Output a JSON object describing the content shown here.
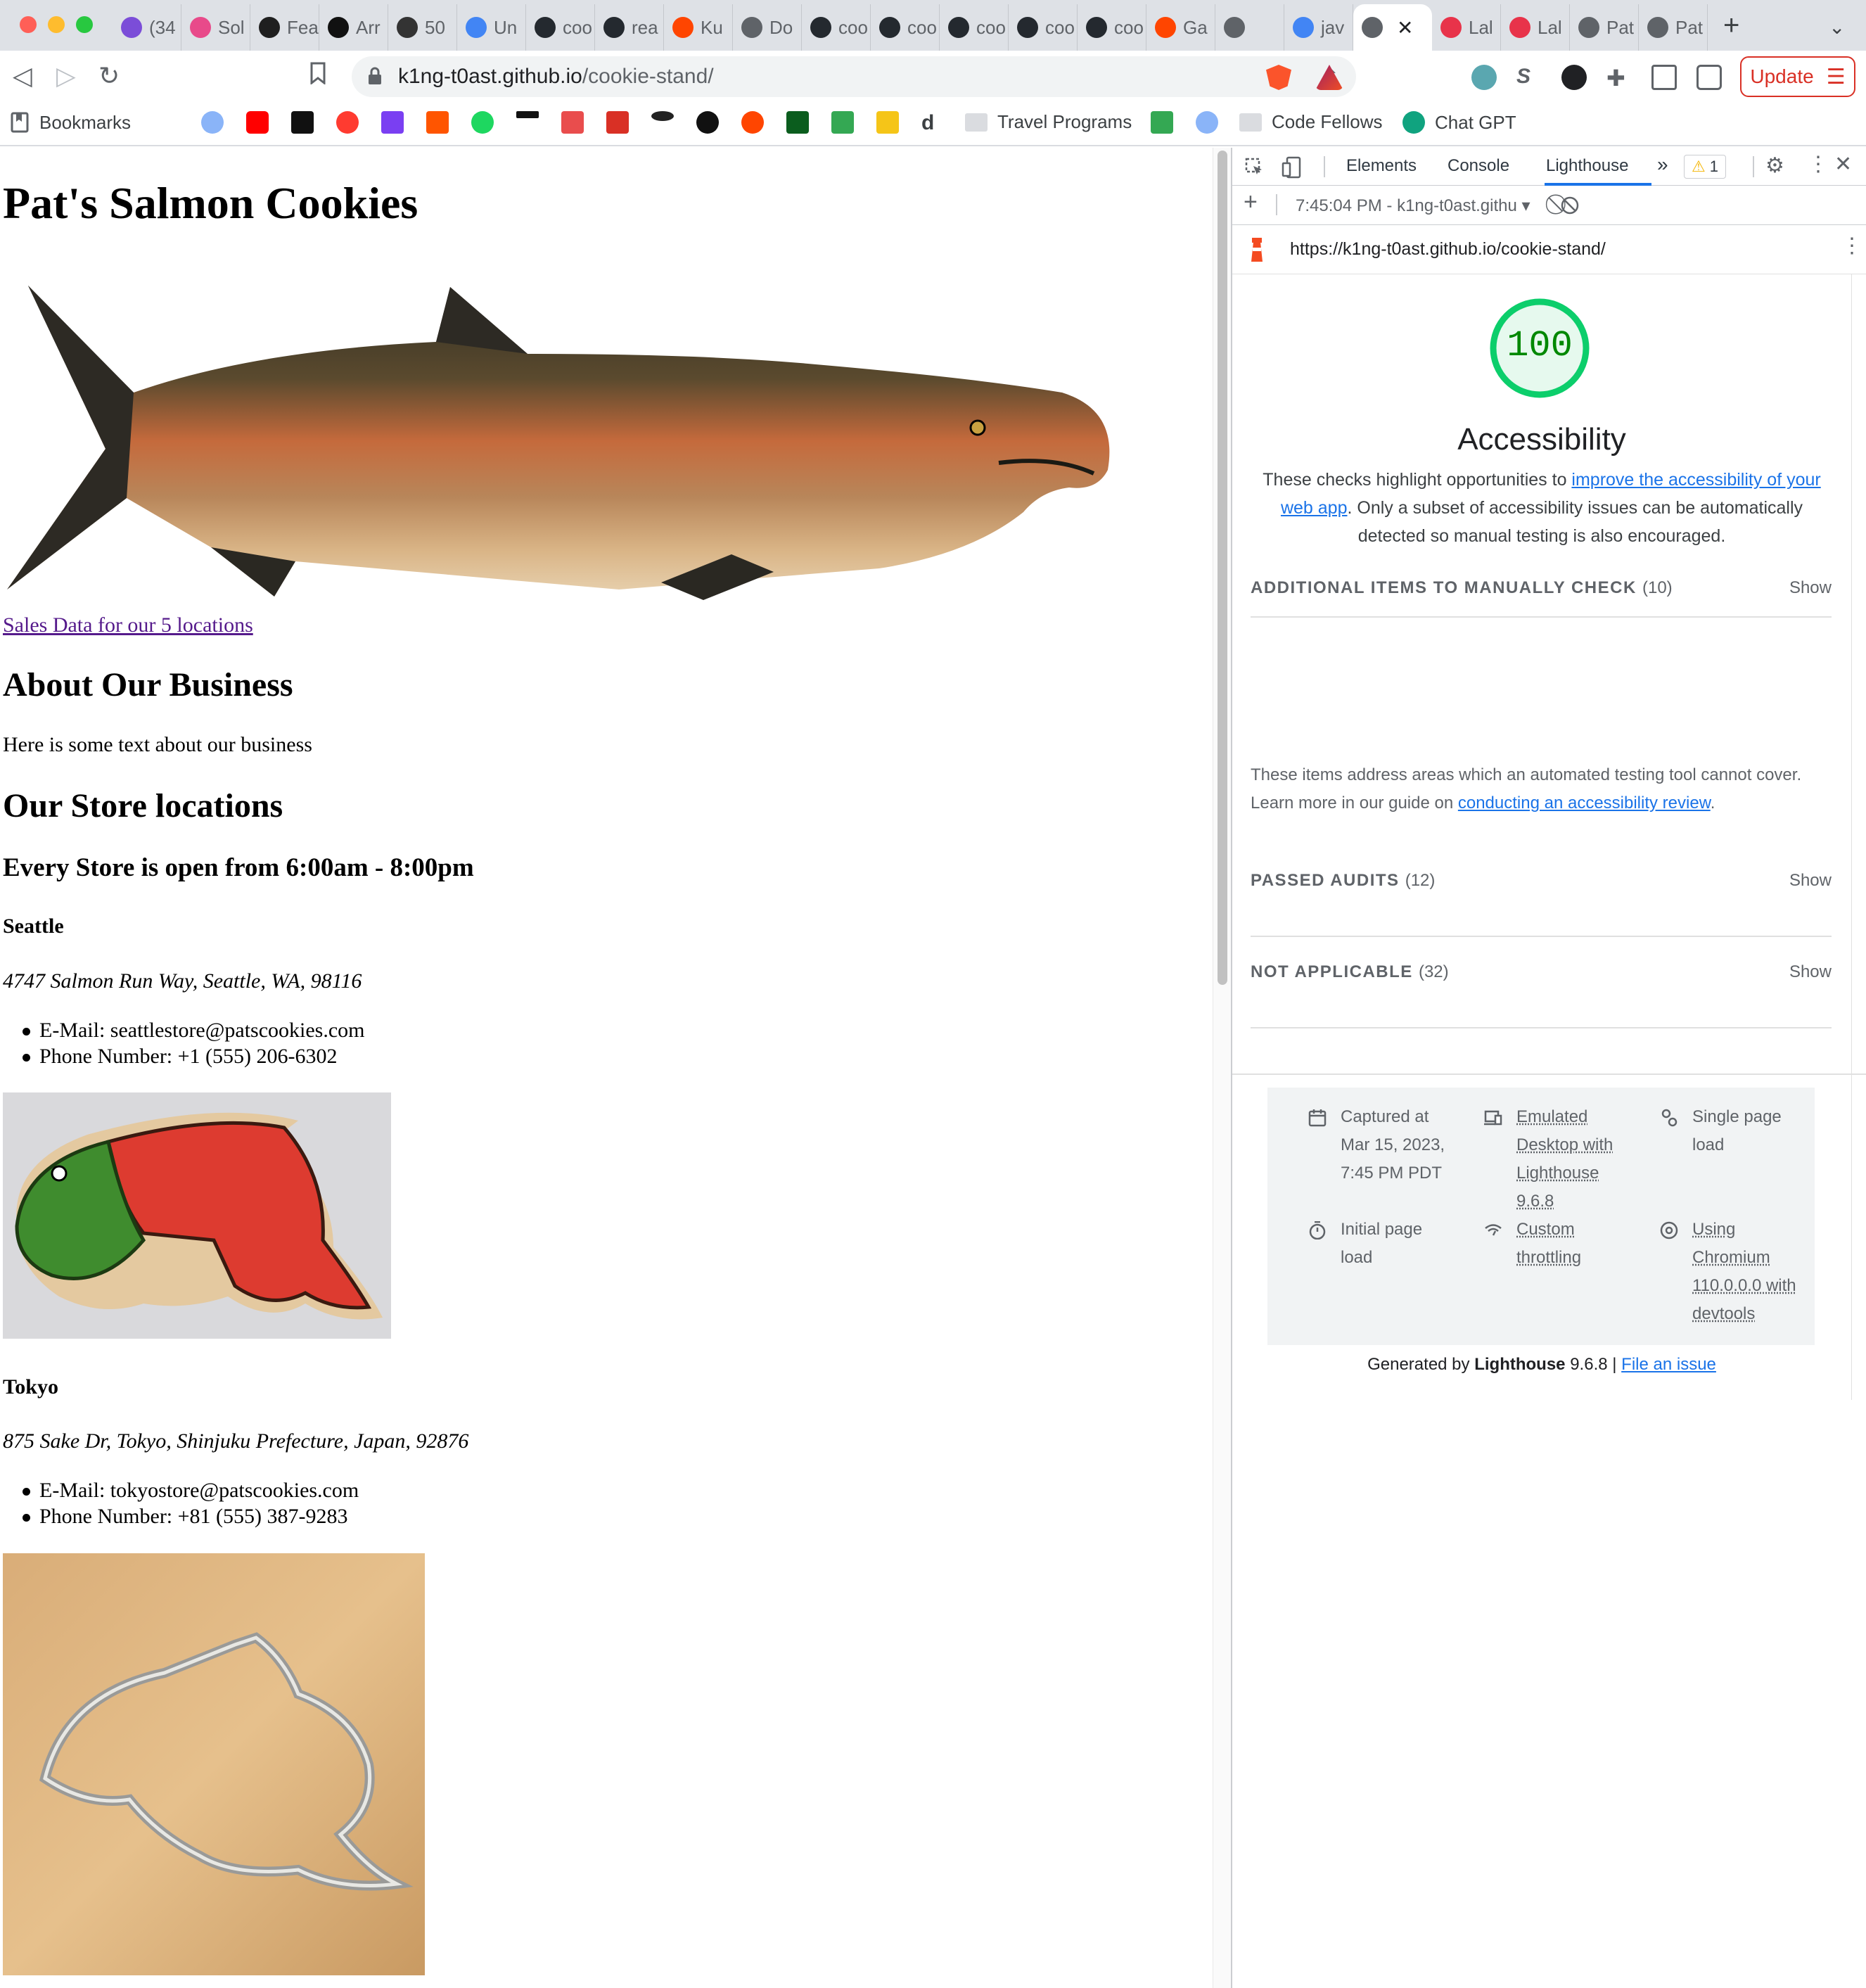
{
  "browser": {
    "tabs": [
      {
        "label": "(34",
        "favicon": "mail-icon",
        "color": "#7b4dd8"
      },
      {
        "label": "Sol",
        "favicon": "swirl-icon",
        "color": "#e84a8a"
      },
      {
        "label": "Fea",
        "favicon": "terminal-icon",
        "color": "#1f1f1f"
      },
      {
        "label": "Arr",
        "favicon": "m-logo-icon",
        "color": "#111111"
      },
      {
        "label": "50",
        "favicon": "paw-icon",
        "color": "#333333"
      },
      {
        "label": "Un",
        "favicon": "docs-icon",
        "color": "#4285f4"
      },
      {
        "label": "coo",
        "favicon": "github-icon",
        "color": "#24292f"
      },
      {
        "label": "rea",
        "favicon": "github-icon",
        "color": "#24292f"
      },
      {
        "label": "Ku",
        "favicon": "reddit-icon",
        "color": "#ff4500"
      },
      {
        "label": "Do",
        "favicon": "globe-icon",
        "color": "#5f6368"
      },
      {
        "label": "coo",
        "favicon": "github-icon",
        "color": "#24292f"
      },
      {
        "label": "coo",
        "favicon": "github-icon",
        "color": "#24292f"
      },
      {
        "label": "coo",
        "favicon": "github-icon",
        "color": "#24292f"
      },
      {
        "label": "coo",
        "favicon": "github-icon",
        "color": "#24292f"
      },
      {
        "label": "coo",
        "favicon": "github-icon",
        "color": "#24292f"
      },
      {
        "label": "Ga",
        "favicon": "reddit-icon",
        "color": "#ff4500"
      },
      {
        "label": "",
        "favicon": "globe-icon",
        "color": "#5f6368"
      },
      {
        "label": "jav",
        "favicon": "google-icon",
        "color": "#4285f4"
      },
      {
        "label": "",
        "favicon": "globe-icon",
        "color": "#5f6368",
        "active": true
      },
      {
        "label": "Lal",
        "favicon": "codefellows-icon",
        "color": "#e8334a"
      },
      {
        "label": "Lal",
        "favicon": "codefellows-icon",
        "color": "#e8334a"
      },
      {
        "label": "Pat",
        "favicon": "globe-icon",
        "color": "#5f6368"
      },
      {
        "label": "Pat",
        "favicon": "globe-icon",
        "color": "#5f6368"
      }
    ],
    "url_host": "k1ng-t0ast.github.io",
    "url_path": "/cookie-stand/",
    "update_label": "Update",
    "bookmarks": {
      "label": "Bookmarks",
      "folders": [
        "Travel Programs",
        "Code Fellows"
      ],
      "chat": "Chat GPT"
    }
  },
  "page": {
    "title": "Pat's Salmon Cookies",
    "sales_link": "Sales Data for our 5 locations",
    "about_heading": "About Our Business",
    "about_text": "Here is some text about our business",
    "locations_heading": "Our Store locations",
    "hours_heading": "Every Store is open from 6:00am - 8:00pm",
    "stores": [
      {
        "name": "Seattle",
        "address": "4747 Salmon Run Way, Seattle, WA, 98116",
        "email": "E-Mail: seattlestore@patscookies.com",
        "phone": "Phone Number: +1 (555) 206-6302"
      },
      {
        "name": "Tokyo",
        "address": "875 Sake Dr, Tokyo, Shinjuku Prefecture, Japan, 92876",
        "email": "E-Mail: tokyostore@patscookies.com",
        "phone": "Phone Number: +81 (555) 387-9283"
      }
    ]
  },
  "devtools": {
    "tabs": [
      "Elements",
      "Console",
      "Lighthouse"
    ],
    "active_tab": "Lighthouse",
    "warning_count": "1",
    "report_selector": "7:45:04 PM - k1ng-t0ast.githu",
    "report_url": "https://k1ng-t0ast.github.io/cookie-stand/",
    "score": "100",
    "score_color": "#0cce6b",
    "category": "Accessibility",
    "desc_pre": "These checks highlight opportunities to ",
    "desc_link": "improve the accessibility of your web app",
    "desc_post": ". Only a subset of accessibility issues can be automatically detected so manual testing is also encouraged.",
    "groups": [
      {
        "title": "ADDITIONAL ITEMS TO MANUALLY CHECK",
        "count": "(10)",
        "show": "Show"
      },
      {
        "title": "PASSED AUDITS",
        "count": "(12)",
        "show": "Show"
      },
      {
        "title": "NOT APPLICABLE",
        "count": "(32)",
        "show": "Show"
      }
    ],
    "manual_desc_pre": "These items address areas which an automated testing tool cannot cover. Learn more in our guide on ",
    "manual_desc_link": "conducting an accessibility review",
    "manual_desc_post": ".",
    "footer": {
      "captured_label": "Captured at",
      "captured_value": "Mar 15, 2023, 7:45 PM PDT",
      "initial": "Initial page load",
      "emulated": "Emulated Desktop with Lighthouse 9.6.8",
      "throttling": "Custom throttling",
      "single": "Single page load",
      "chromium": "Using Chromium 110.0.0.0 with devtools"
    },
    "generated_pre": "Generated by ",
    "generated_brand": "Lighthouse",
    "generated_version": " 9.6.8 | ",
    "file_issue": "File an issue"
  }
}
